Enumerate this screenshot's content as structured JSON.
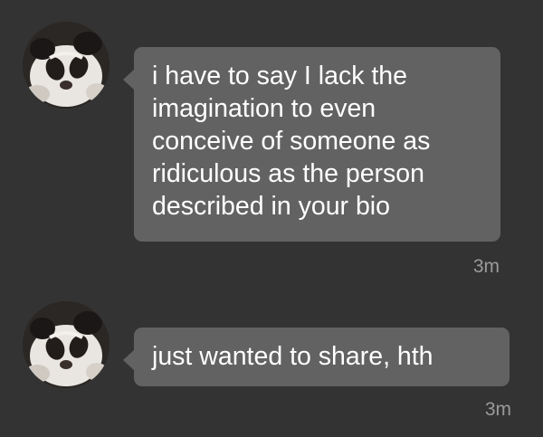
{
  "messages": [
    {
      "avatar": "panda-plush-avatar",
      "text": "i have to say I lack the\nimagination to even\nconceive of someone as\nridiculous as the person\ndescribed in your bio",
      "time": "3m"
    },
    {
      "avatar": "panda-plush-avatar",
      "text": "just wanted to share, hth",
      "time": "3m"
    }
  ],
  "colors": {
    "background": "#333333",
    "bubble": "#626262",
    "text": "#ffffff",
    "timestamp": "#9a9a9a"
  }
}
